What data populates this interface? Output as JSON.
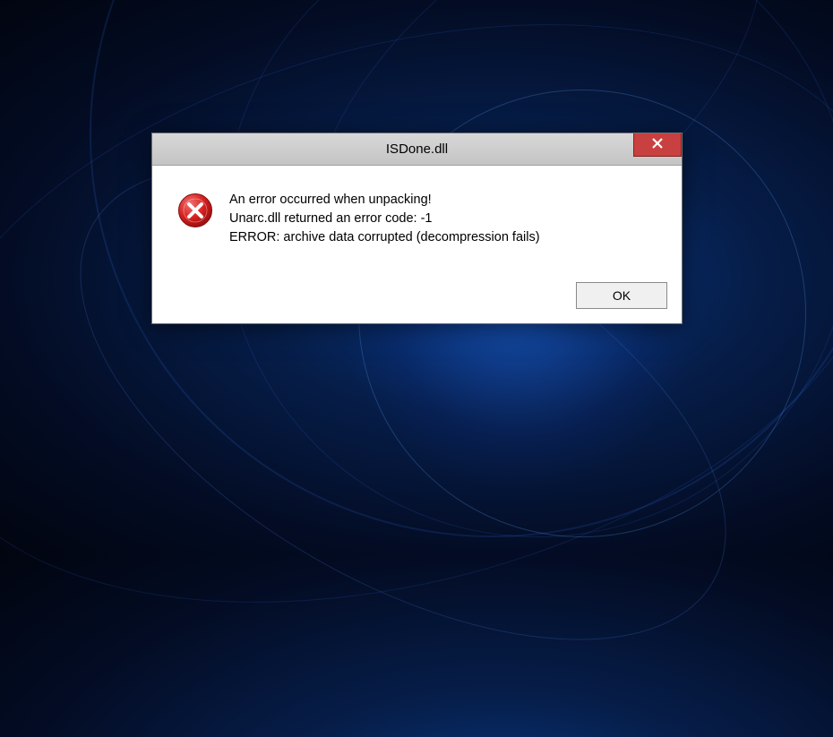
{
  "dialog": {
    "title": "ISDone.dll",
    "close_icon": "close",
    "error_icon": "error",
    "message": {
      "line1": "An error occurred when unpacking!",
      "line2": "Unarc.dll returned an error code: -1",
      "line3": "ERROR: archive data corrupted (decompression fails)"
    },
    "ok_label": "OK"
  }
}
